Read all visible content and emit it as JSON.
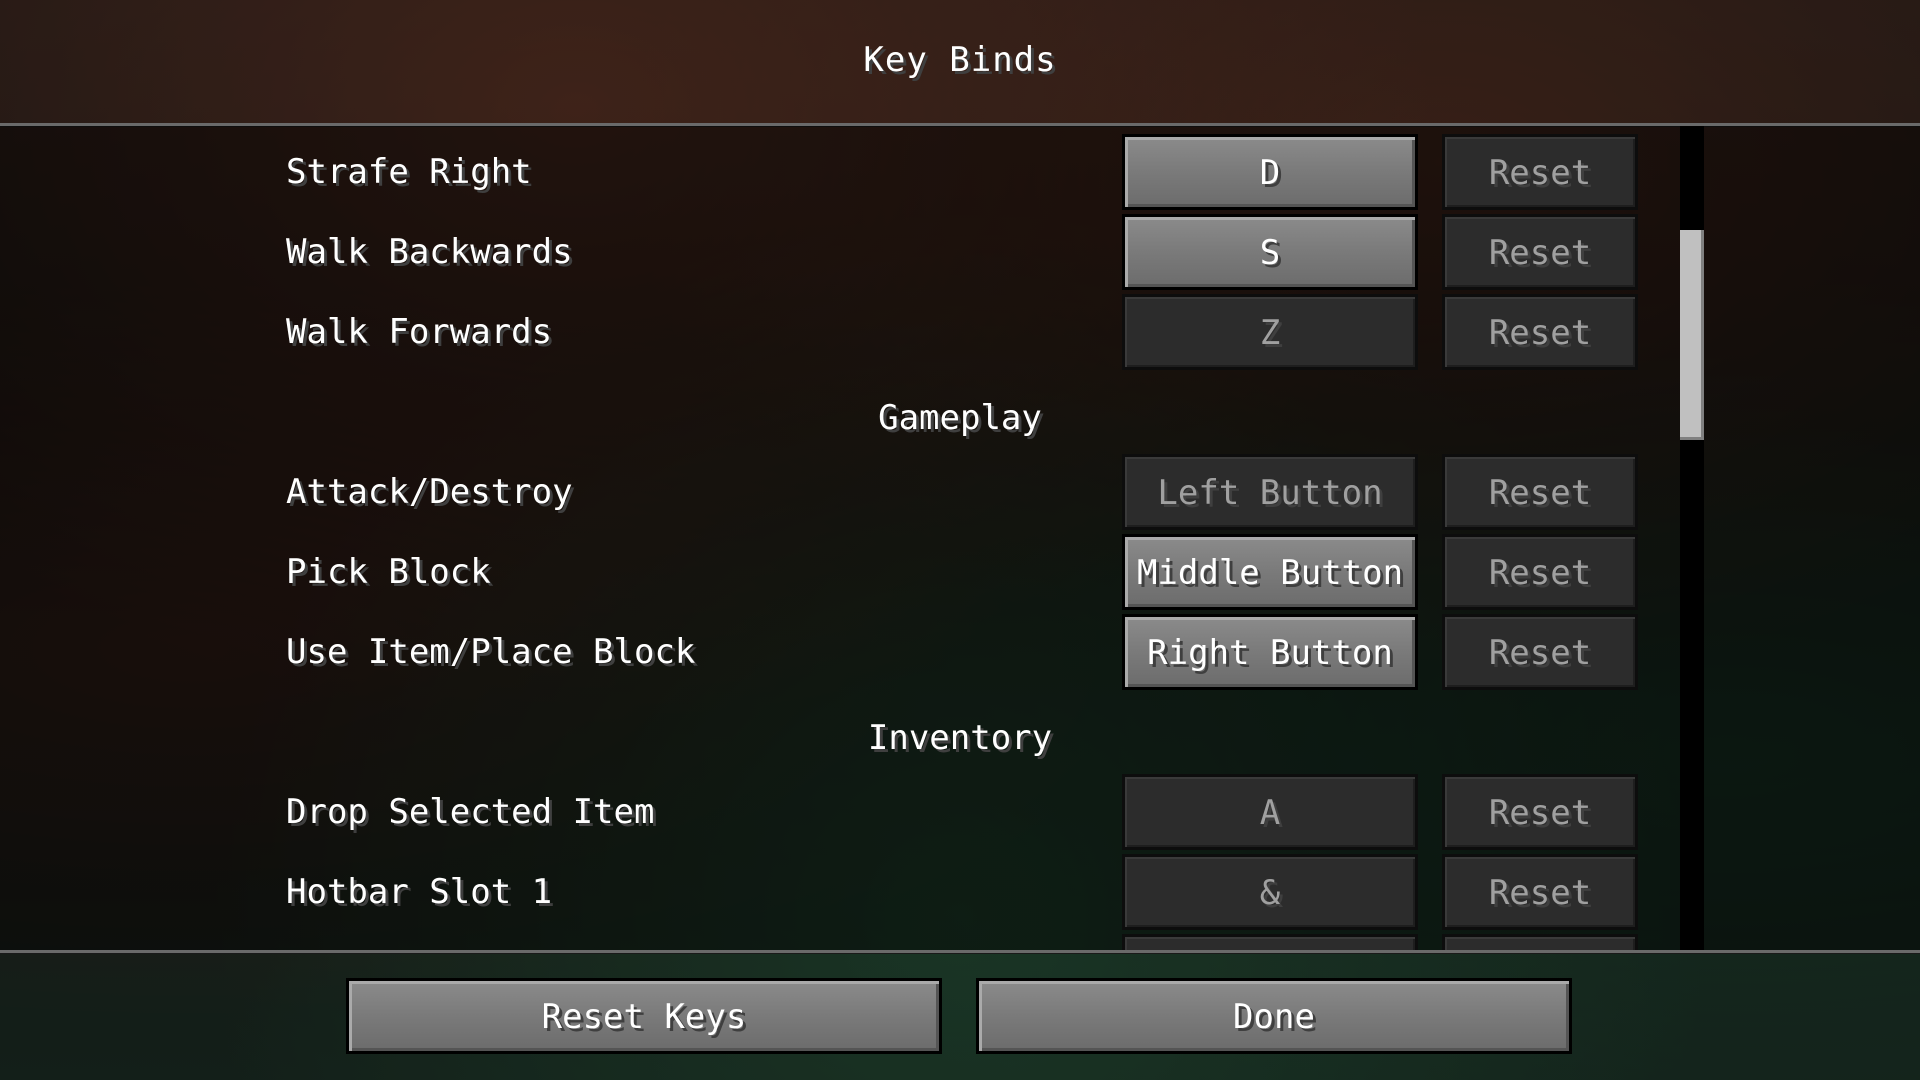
{
  "screen": {
    "title": "Key Binds"
  },
  "rows": [
    {
      "label": "Strafe Right",
      "key": "D",
      "reset": "Reset"
    },
    {
      "label": "Walk Backwards",
      "key": "S",
      "reset": "Reset"
    },
    {
      "label": "Walk Forwards",
      "key": "Z",
      "reset": "Reset"
    },
    {
      "category": "Gameplay"
    },
    {
      "label": "Attack/Destroy",
      "key": "Left Button",
      "reset": "Reset"
    },
    {
      "label": "Pick Block",
      "key": "Middle Button",
      "reset": "Reset"
    },
    {
      "label": "Use Item/Place Block",
      "key": "Right Button",
      "reset": "Reset"
    },
    {
      "category": "Inventory"
    },
    {
      "label": "Drop Selected Item",
      "key": "A",
      "reset": "Reset"
    },
    {
      "label": "Hotbar Slot 1",
      "key": "&",
      "reset": "Reset"
    }
  ],
  "footer": {
    "reset_keys": "Reset Keys",
    "done": "Done"
  }
}
